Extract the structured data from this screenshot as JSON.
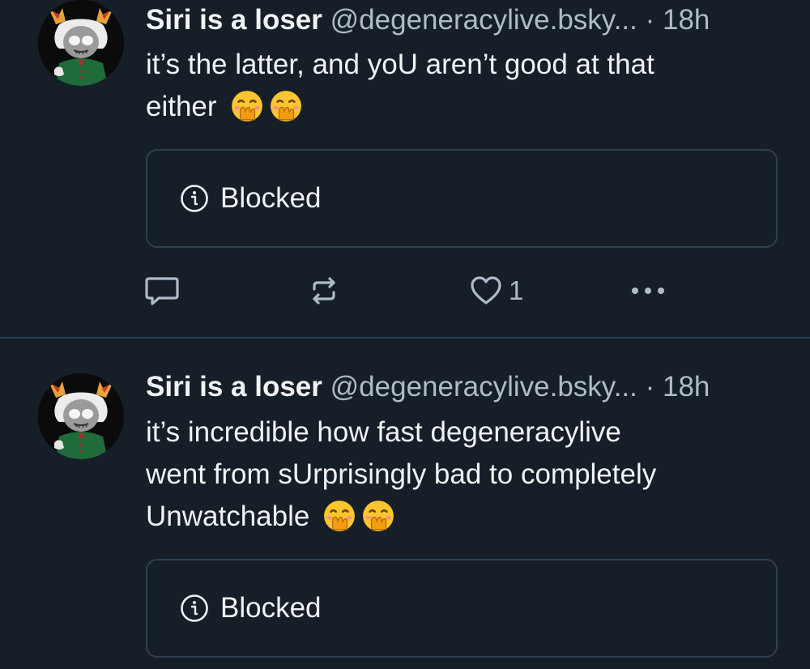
{
  "colors": {
    "background": "#161e27",
    "text": "#f1f3f5",
    "muted": "#aebbc9",
    "border": "#2e4052"
  },
  "posts": [
    {
      "author": {
        "display_name": "Siri is a loser",
        "handle": "@degeneracylive.bsky...",
        "avatar": "avatar"
      },
      "separator": "·",
      "time": "18h",
      "text_lines": [
        "it’s the latter, and yoU aren’t good at that",
        "either"
      ],
      "emojis": [
        "face-with-hand-over-mouth",
        "face-with-hand-over-mouth"
      ],
      "quote": {
        "icon": "info-icon",
        "label": "Blocked"
      },
      "actions": {
        "reply_icon": "reply-icon",
        "repost_icon": "repost-icon",
        "like_icon": "heart-icon",
        "like_count": "1",
        "more_icon": "more-icon"
      }
    },
    {
      "author": {
        "display_name": "Siri is a loser",
        "handle": "@degeneracylive.bsky...",
        "avatar": "avatar"
      },
      "separator": "·",
      "time": "18h",
      "text_lines": [
        "it’s incredible how fast degeneracylive",
        "went from sUrprisingly bad to completely",
        "Unwatchable"
      ],
      "emojis": [
        "face-with-hand-over-mouth",
        "face-with-hand-over-mouth"
      ],
      "quote": {
        "icon": "info-icon",
        "label": "Blocked"
      }
    }
  ]
}
